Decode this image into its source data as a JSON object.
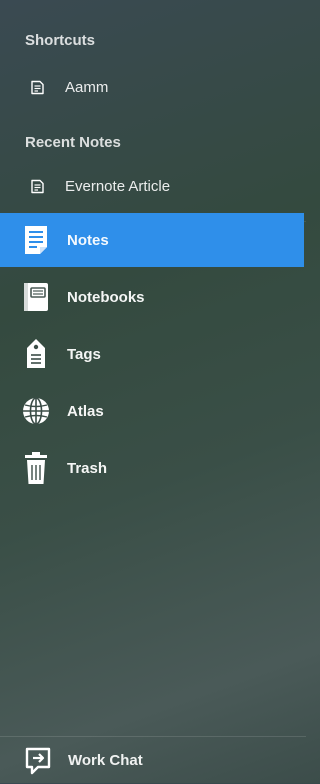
{
  "shortcuts": {
    "header": "Shortcuts",
    "items": [
      {
        "label": "Aamm",
        "icon": "note-icon"
      }
    ]
  },
  "recent_notes": {
    "header": "Recent Notes",
    "items": [
      {
        "label": "Evernote Article",
        "icon": "note-icon"
      }
    ]
  },
  "nav": {
    "items": [
      {
        "label": "Notes",
        "icon": "notes-icon",
        "active": true
      },
      {
        "label": "Notebooks",
        "icon": "notebook-icon",
        "active": false
      },
      {
        "label": "Tags",
        "icon": "tag-icon",
        "active": false
      },
      {
        "label": "Atlas",
        "icon": "globe-icon",
        "active": false
      },
      {
        "label": "Trash",
        "icon": "trash-icon",
        "active": false
      }
    ]
  },
  "footer": {
    "label": "Work Chat",
    "icon": "work-chat-icon"
  },
  "colors": {
    "active_background": "#2f8fea",
    "text": "#ffffff"
  }
}
